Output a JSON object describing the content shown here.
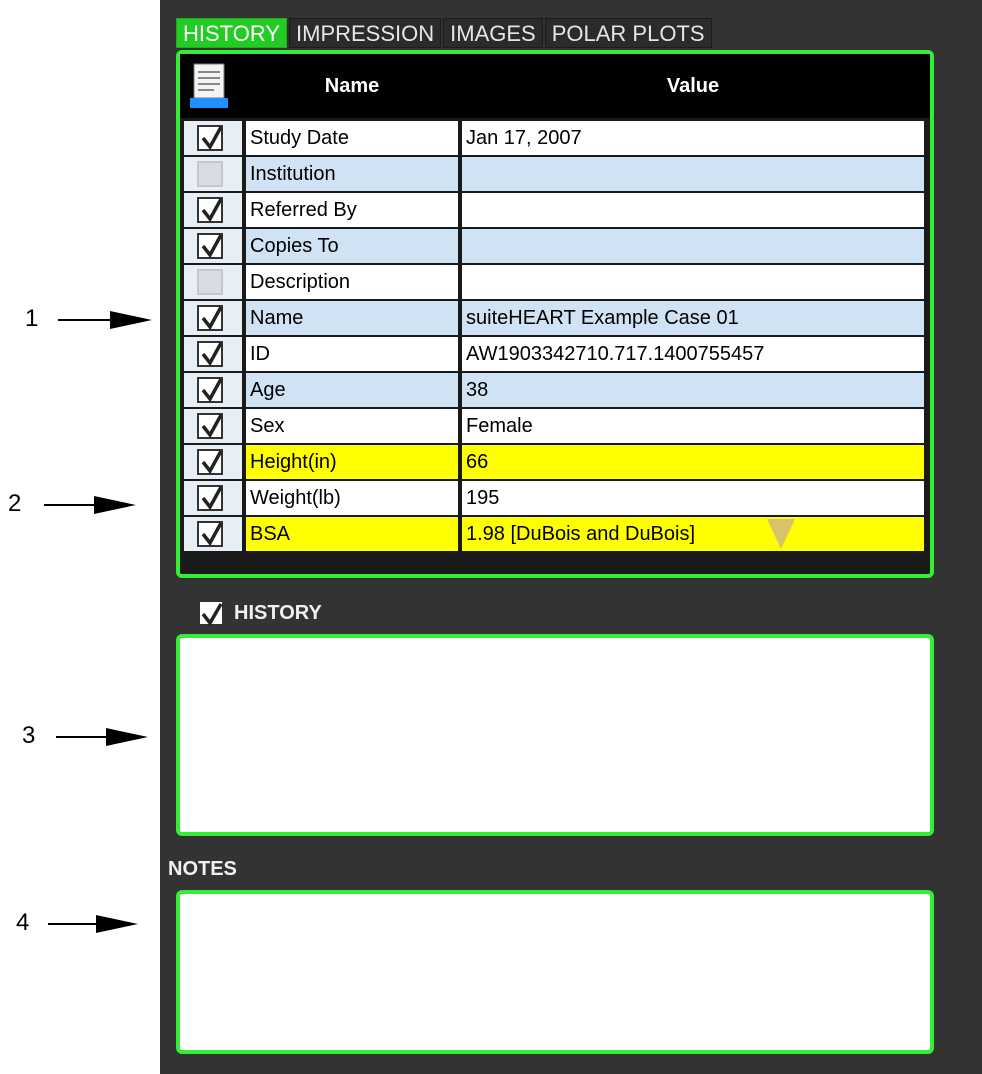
{
  "tabs": [
    {
      "label": "HISTORY",
      "active": true
    },
    {
      "label": "IMPRESSION",
      "active": false
    },
    {
      "label": "IMAGES",
      "active": false
    },
    {
      "label": "POLAR PLOTS",
      "active": false
    }
  ],
  "table": {
    "header": {
      "name": "Name",
      "value": "Value"
    },
    "rows": [
      {
        "checked": true,
        "name": "Study Date",
        "value": "Jan 17, 2007",
        "bg": "white"
      },
      {
        "checked": false,
        "name": "Institution",
        "value": "",
        "bg": "blue"
      },
      {
        "checked": true,
        "name": "Referred By",
        "value": "",
        "bg": "white"
      },
      {
        "checked": true,
        "name": "Copies To",
        "value": "",
        "bg": "blue"
      },
      {
        "checked": false,
        "name": "Description",
        "value": "",
        "bg": "white"
      },
      {
        "checked": true,
        "name": "Name",
        "value": "suiteHEART Example Case 01",
        "bg": "blue"
      },
      {
        "checked": true,
        "name": "ID",
        "value": "AW1903342710.717.1400755457",
        "bg": "white"
      },
      {
        "checked": true,
        "name": "Age",
        "value": "38",
        "bg": "blue"
      },
      {
        "checked": true,
        "name": "Sex",
        "value": "Female",
        "bg": "white"
      },
      {
        "checked": true,
        "name": "Height(in)",
        "value": "66",
        "bg": "yellow"
      },
      {
        "checked": true,
        "name": "Weight(lb)",
        "value": "195",
        "bg": "white"
      },
      {
        "checked": true,
        "name": "BSA",
        "value": "1.98 [DuBois and DuBois]",
        "bg": "yellow",
        "dropdown": true
      }
    ]
  },
  "history": {
    "label": "HISTORY",
    "checked": true,
    "text": ""
  },
  "notes": {
    "label": "NOTES",
    "text": ""
  },
  "callouts": [
    {
      "num": "1"
    },
    {
      "num": "2"
    },
    {
      "num": "3"
    },
    {
      "num": "4"
    }
  ],
  "colors": {
    "panel": "#333333",
    "accent_green": "#33ee33",
    "row_blue": "#cfe3f5",
    "row_yellow": "#ffff00",
    "header": "#000000"
  },
  "icons": {
    "report": "document-icon",
    "check": "checkmark-icon",
    "dropdown": "dropdown-triangle-icon"
  }
}
